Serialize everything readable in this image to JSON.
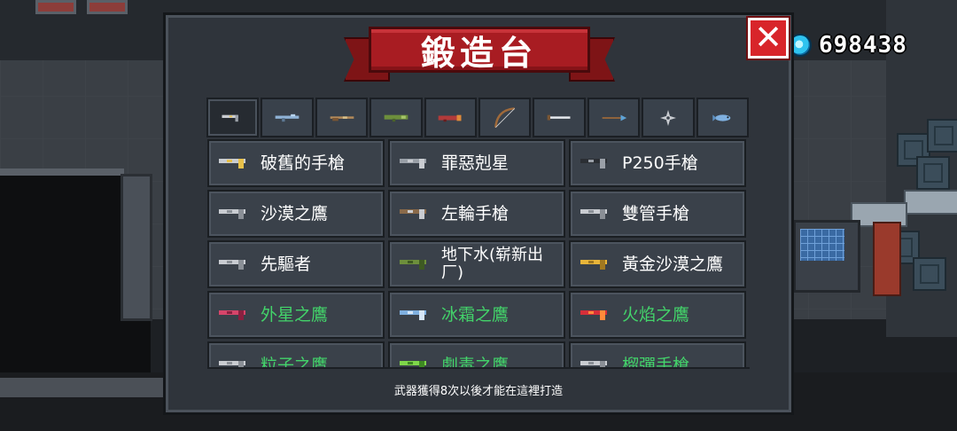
{
  "currency": {
    "icon": "gem-icon",
    "value": "698438"
  },
  "panel": {
    "title": "鍛造台",
    "close_label": "✕",
    "footer": "武器獲得8次以後才能在這裡打造"
  },
  "tabs": [
    {
      "icon": "pistol-icon",
      "active": true
    },
    {
      "icon": "rifle-icon",
      "active": false
    },
    {
      "icon": "shotgun-icon",
      "active": false
    },
    {
      "icon": "launcher-icon",
      "active": false
    },
    {
      "icon": "rocket-icon",
      "active": false
    },
    {
      "icon": "bow-icon",
      "active": false
    },
    {
      "icon": "sword-icon",
      "active": false
    },
    {
      "icon": "spear-icon",
      "active": false
    },
    {
      "icon": "shuriken-icon",
      "active": false
    },
    {
      "icon": "fish-icon",
      "active": false
    }
  ],
  "weapons": [
    {
      "name": "破舊的手槍",
      "color": "#ffffff",
      "icon": "old-pistol-icon"
    },
    {
      "name": "罪惡剋星",
      "color": "#ffffff",
      "icon": "bad-pistol-icon"
    },
    {
      "name": "P250手槍",
      "color": "#ffffff",
      "icon": "p250-icon"
    },
    {
      "name": "沙漠之鷹",
      "color": "#ffffff",
      "icon": "desert-eagle-icon"
    },
    {
      "name": "左輪手槍",
      "color": "#ffffff",
      "icon": "revolver-icon"
    },
    {
      "name": "雙管手槍",
      "color": "#ffffff",
      "icon": "double-barrel-icon"
    },
    {
      "name": "先驅者",
      "color": "#ffffff",
      "icon": "pioneer-icon"
    },
    {
      "name": "地下水(崭新出厂)",
      "color": "#ffffff",
      "icon": "uzi-icon"
    },
    {
      "name": "黃金沙漠之鷹",
      "color": "#ffffff",
      "icon": "golden-eagle-icon"
    },
    {
      "name": "外星之鷹",
      "color": "#43d36a",
      "icon": "alien-eagle-icon"
    },
    {
      "name": "冰霜之鷹",
      "color": "#43d36a",
      "icon": "frost-eagle-icon"
    },
    {
      "name": "火焰之鷹",
      "color": "#43d36a",
      "icon": "fire-eagle-icon"
    },
    {
      "name": "粒子之鷹",
      "color": "#43d36a",
      "icon": "particle-eagle-icon"
    },
    {
      "name": "劇毒之鷹",
      "color": "#43d36a",
      "icon": "poison-eagle-icon"
    },
    {
      "name": "榴彈手槍",
      "color": "#43d36a",
      "icon": "grenade-pistol-icon"
    }
  ]
}
